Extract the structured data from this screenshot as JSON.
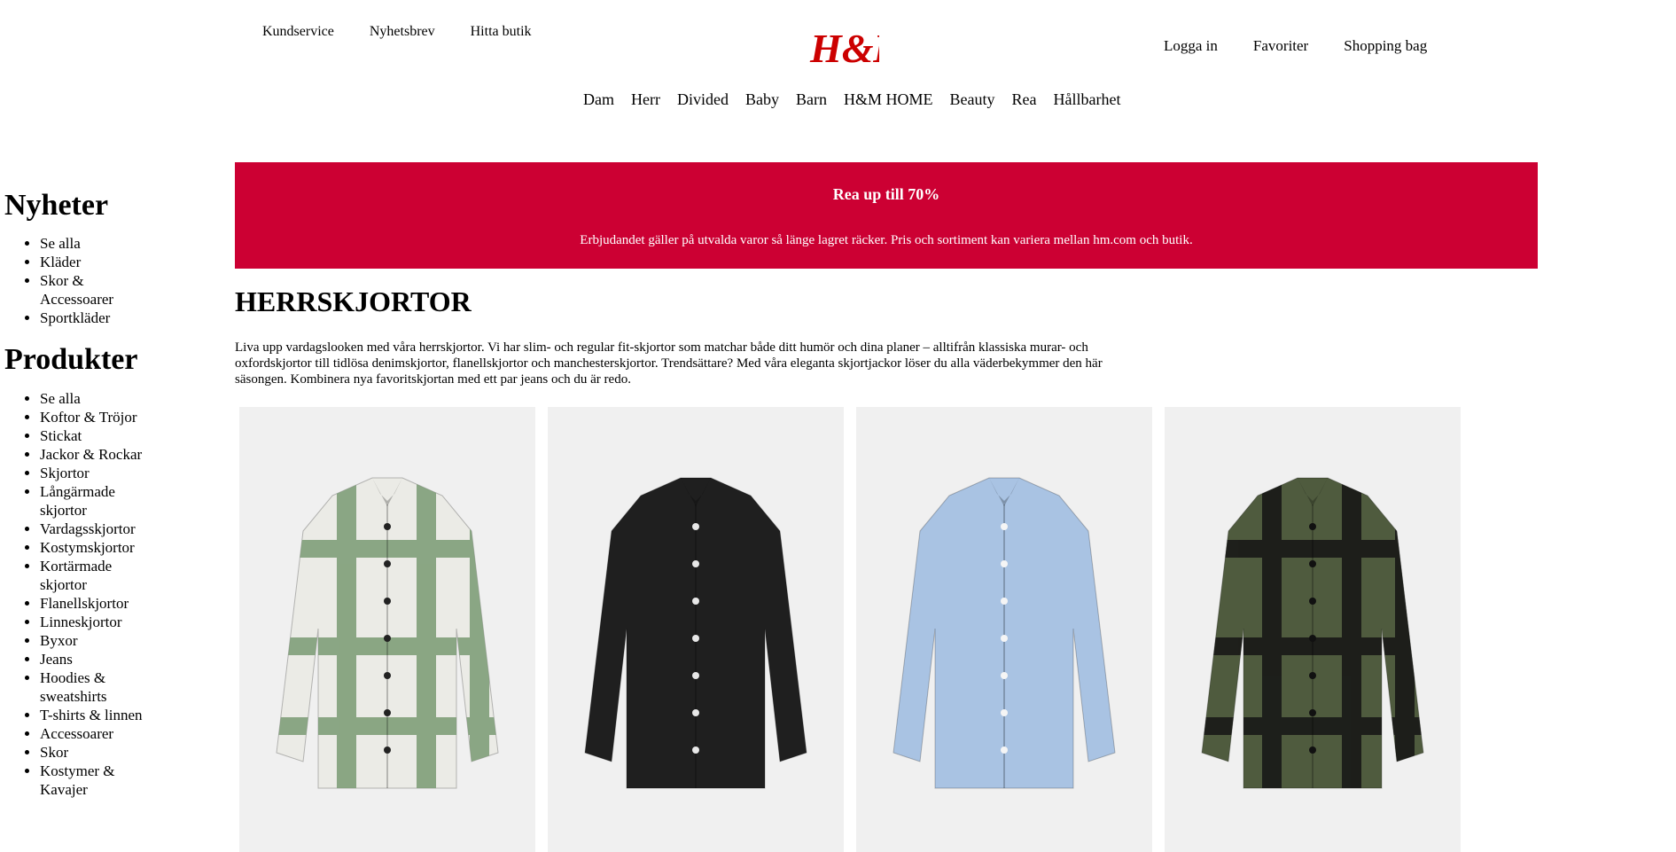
{
  "header": {
    "top_links": [
      "Kundservice",
      "Nyhetsbrev",
      "Hitta butik"
    ],
    "logo_text": "H&M",
    "account_links": [
      "Logga in",
      "Favoriter",
      "Shopping bag"
    ],
    "nav": [
      "Dam",
      "Herr",
      "Divided",
      "Baby",
      "Barn",
      "H&M HOME",
      "Beauty",
      "Rea",
      "Hållbarhet"
    ]
  },
  "sidebar": {
    "sections": [
      {
        "title": "Nyheter",
        "items": [
          "Se alla",
          "Kläder",
          "Skor & Accessoarer",
          "Sportkläder"
        ]
      },
      {
        "title": "Produkter",
        "items": [
          "Se alla",
          "Koftor & Tröjor",
          "Stickat",
          "Jackor & Rockar",
          "Skjortor",
          "Långärmade skjortor",
          "Vardagsskjortor",
          "Kostymskjortor",
          "Kortärmade skjortor",
          "Flanellskjortor",
          "Linneskjortor",
          "Byxor",
          "Jeans",
          "Hoodies & sweatshirts",
          "T-shirts & linnen",
          "Accessoarer",
          "Skor",
          "Kostymer & Kavajer"
        ]
      }
    ]
  },
  "banner": {
    "title": "Rea up till 70%",
    "text": "Erbjudandet gäller på utvalda varor så länge lagret räcker. Pris och sortiment kan variera mellan hm.com och butik.",
    "color": "#cc0033"
  },
  "page": {
    "title": "HERRSKJORTOR",
    "intro": "Liva upp vardagslooken med våra herrskjortor. Vi har slim- och regular fit-skjortor som matchar både ditt humör och dina planer – alltifrån klassiska murar- och oxfordskjortor till tidlösa denimskjortor, flanellskjortor och manchesterskjortor. Trendsättare? Med våra eleganta skjortjackor löser du alla väderbekymmer den här säsongen. Kombinera nya favoritskjortan med ett par jeans och du är redo."
  },
  "products": [
    {
      "icon": "checked-overshirt-green-image",
      "base": "#ebebe6",
      "stripe": "#7a9a72",
      "button": "#222222"
    },
    {
      "icon": "black-shirt-image",
      "base": "#1f1f1f",
      "stripe": "#1f1f1f",
      "button": "#e8e8e8"
    },
    {
      "icon": "light-blue-shirt-image",
      "base": "#a9c3e3",
      "stripe": "#a9c3e3",
      "button": "#f5f5f5"
    },
    {
      "icon": "checked-flannel-shirt-image",
      "base": "#4f5b3e",
      "stripe": "#151515",
      "button": "#111111"
    }
  ]
}
